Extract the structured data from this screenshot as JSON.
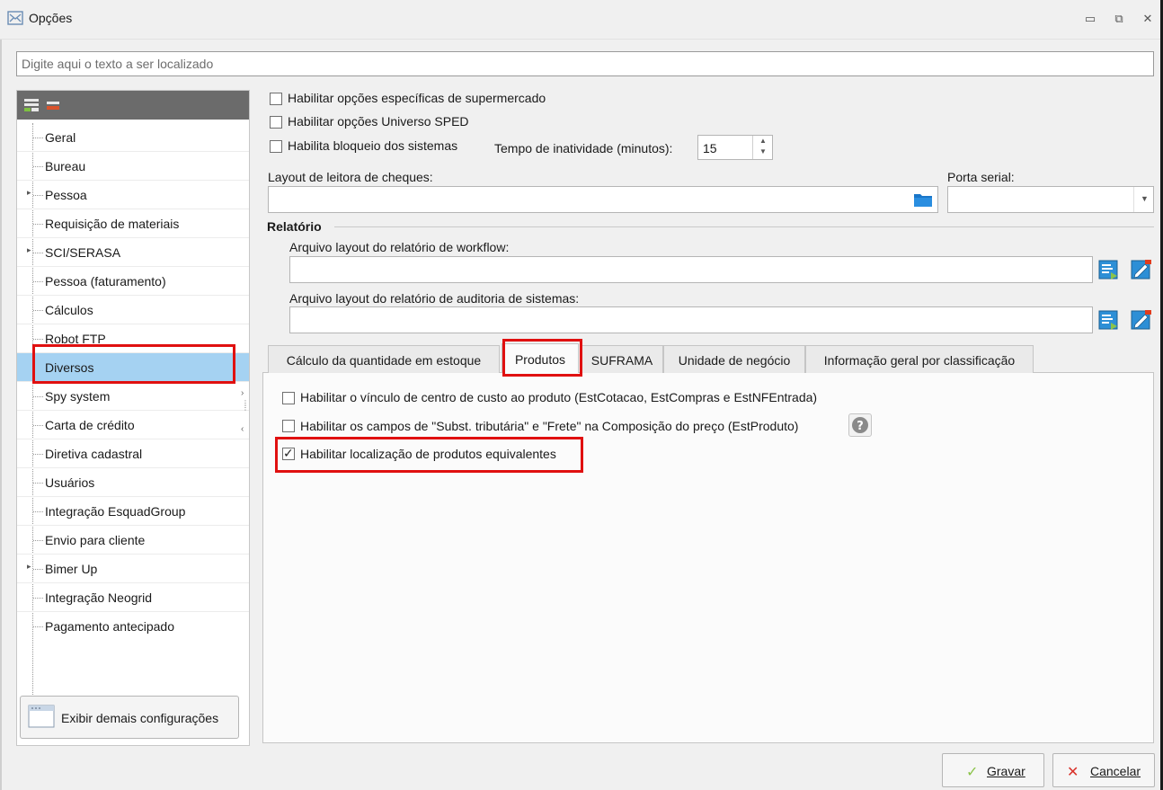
{
  "window": {
    "title": "Opções",
    "minimize": "▭",
    "maximize": "⧉",
    "close": "✕"
  },
  "search": {
    "placeholder": "Digite aqui o texto a ser localizado",
    "value": ""
  },
  "sidebar": {
    "items": [
      {
        "label": "Geral"
      },
      {
        "label": "Bureau"
      },
      {
        "label": "Pessoa"
      },
      {
        "label": "Requisição de materiais"
      },
      {
        "label": "SCI/SERASA"
      },
      {
        "label": "Pessoa (faturamento)"
      },
      {
        "label": "Cálculos"
      },
      {
        "label": "Robot FTP"
      },
      {
        "label": "Diversos"
      },
      {
        "label": "Spy system"
      },
      {
        "label": "Carta de crédito"
      },
      {
        "label": "Diretiva cadastral"
      },
      {
        "label": "Usuários"
      },
      {
        "label": "Integração EsquadGroup"
      },
      {
        "label": "Envio para cliente"
      },
      {
        "label": "Bimer Up"
      },
      {
        "label": "Integração Neogrid"
      },
      {
        "label": "Pagamento antecipado"
      }
    ],
    "selected_index": 8,
    "more_button": "Exibir demais configurações"
  },
  "options": {
    "supermercado": "Habilitar opções específicas de supermercado",
    "sped": "Habilitar opções Universo SPED",
    "bloqueio": "Habilita bloqueio dos sistemas",
    "tempo_label": "Tempo de inatividade (minutos):",
    "tempo_value": "15",
    "layout_cheques_label": "Layout de leitora de cheques:",
    "porta_serial_label": "Porta serial:"
  },
  "relatorio": {
    "group_title": "Relatório",
    "workflow_label": "Arquivo layout do relatório de workflow:",
    "auditoria_label": "Arquivo layout do relatório de auditoria de sistemas:"
  },
  "tabs": [
    {
      "label": "Cálculo da quantidade em estoque"
    },
    {
      "label": "Produtos"
    },
    {
      "label": "SUFRAMA"
    },
    {
      "label": "Unidade de negócio"
    },
    {
      "label": "Informação geral por classificação"
    }
  ],
  "produtos": {
    "centro_custo": "Habilitar o vínculo de centro de custo ao produto (EstCotacao, EstCompras e EstNFEntrada)",
    "subst_frete": "Habilitar os campos de \"Subst. tributária\" e \"Frete\" na Composição do preço (EstProduto)",
    "equivalentes": "Habilitar localização de produtos equivalentes"
  },
  "footer": {
    "gravar": "Gravar",
    "cancelar": "Cancelar"
  },
  "colors": {
    "selection": "#a5d2f2",
    "annotation": "#e01010",
    "toolbar": "#6b6b6b"
  }
}
